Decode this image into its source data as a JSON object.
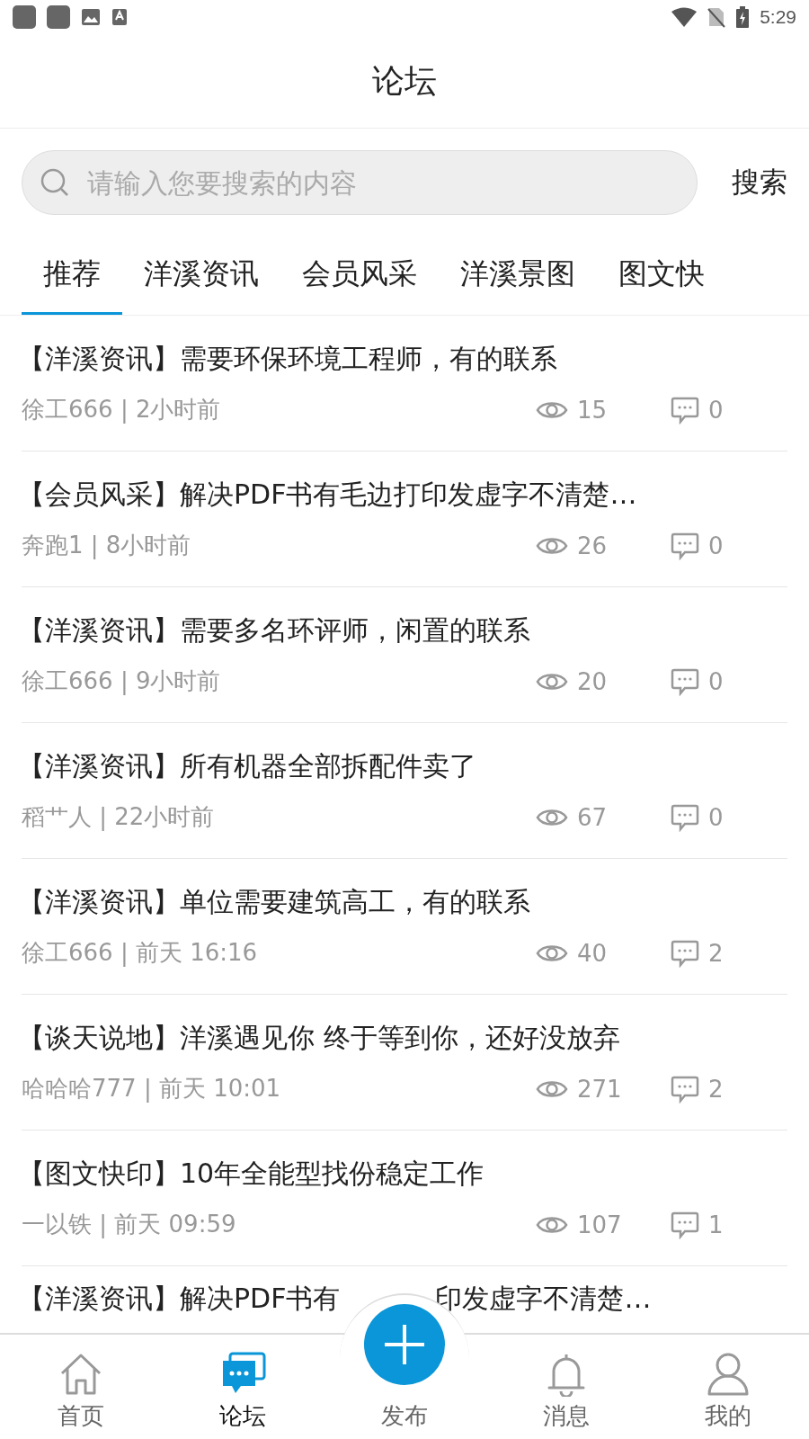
{
  "status_bar": {
    "time": "5:29"
  },
  "header": {
    "title": "论坛"
  },
  "search": {
    "placeholder": "请输入您要搜索的内容",
    "button": "搜索"
  },
  "tabs": [
    {
      "label": "推荐",
      "selected": true
    },
    {
      "label": "洋溪资讯",
      "selected": false
    },
    {
      "label": "会员风采",
      "selected": false
    },
    {
      "label": "洋溪景图",
      "selected": false
    },
    {
      "label": "图文快",
      "selected": false
    }
  ],
  "posts": [
    {
      "title": "【洋溪资讯】需要环保环境工程师，有的联系",
      "meta": "徐工666 | 2小时前",
      "views": "15",
      "comments": "0"
    },
    {
      "title": "【会员风采】解决PDF书有毛边打印发虚字不清楚…",
      "meta": "奔跑1 | 8小时前",
      "views": "26",
      "comments": "0"
    },
    {
      "title": "【洋溪资讯】需要多名环评师，闲置的联系",
      "meta": "徐工666 | 9小时前",
      "views": "20",
      "comments": "0"
    },
    {
      "title": "【洋溪资讯】所有机器全部拆配件卖了",
      "meta": "稻艹人 | 22小时前",
      "views": "67",
      "comments": "0"
    },
    {
      "title": "【洋溪资讯】单位需要建筑高工，有的联系",
      "meta": "徐工666 | 前天 16:16",
      "views": "40",
      "comments": "2"
    },
    {
      "title": "【谈天说地】洋溪遇见你 终于等到你，还好没放弃",
      "meta": "哈哈哈777 | 前天 10:01",
      "views": "271",
      "comments": "2"
    },
    {
      "title": "【图文快印】10年全能型找份稳定工作",
      "meta": "一以铁 | 前天 09:59",
      "views": "107",
      "comments": "1"
    }
  ],
  "partial_post": {
    "title_start": "【洋溪资讯】解决PDF书有",
    "title_end": "印发虚字不清楚…"
  },
  "bottom_nav": [
    {
      "label": "首页",
      "kind": "home",
      "selected": false
    },
    {
      "label": "论坛",
      "kind": "forum",
      "selected": true
    },
    {
      "label": "发布",
      "kind": "publish",
      "selected": false
    },
    {
      "label": "消息",
      "kind": "bell",
      "selected": false
    },
    {
      "label": "我的",
      "kind": "person",
      "selected": false
    }
  ]
}
